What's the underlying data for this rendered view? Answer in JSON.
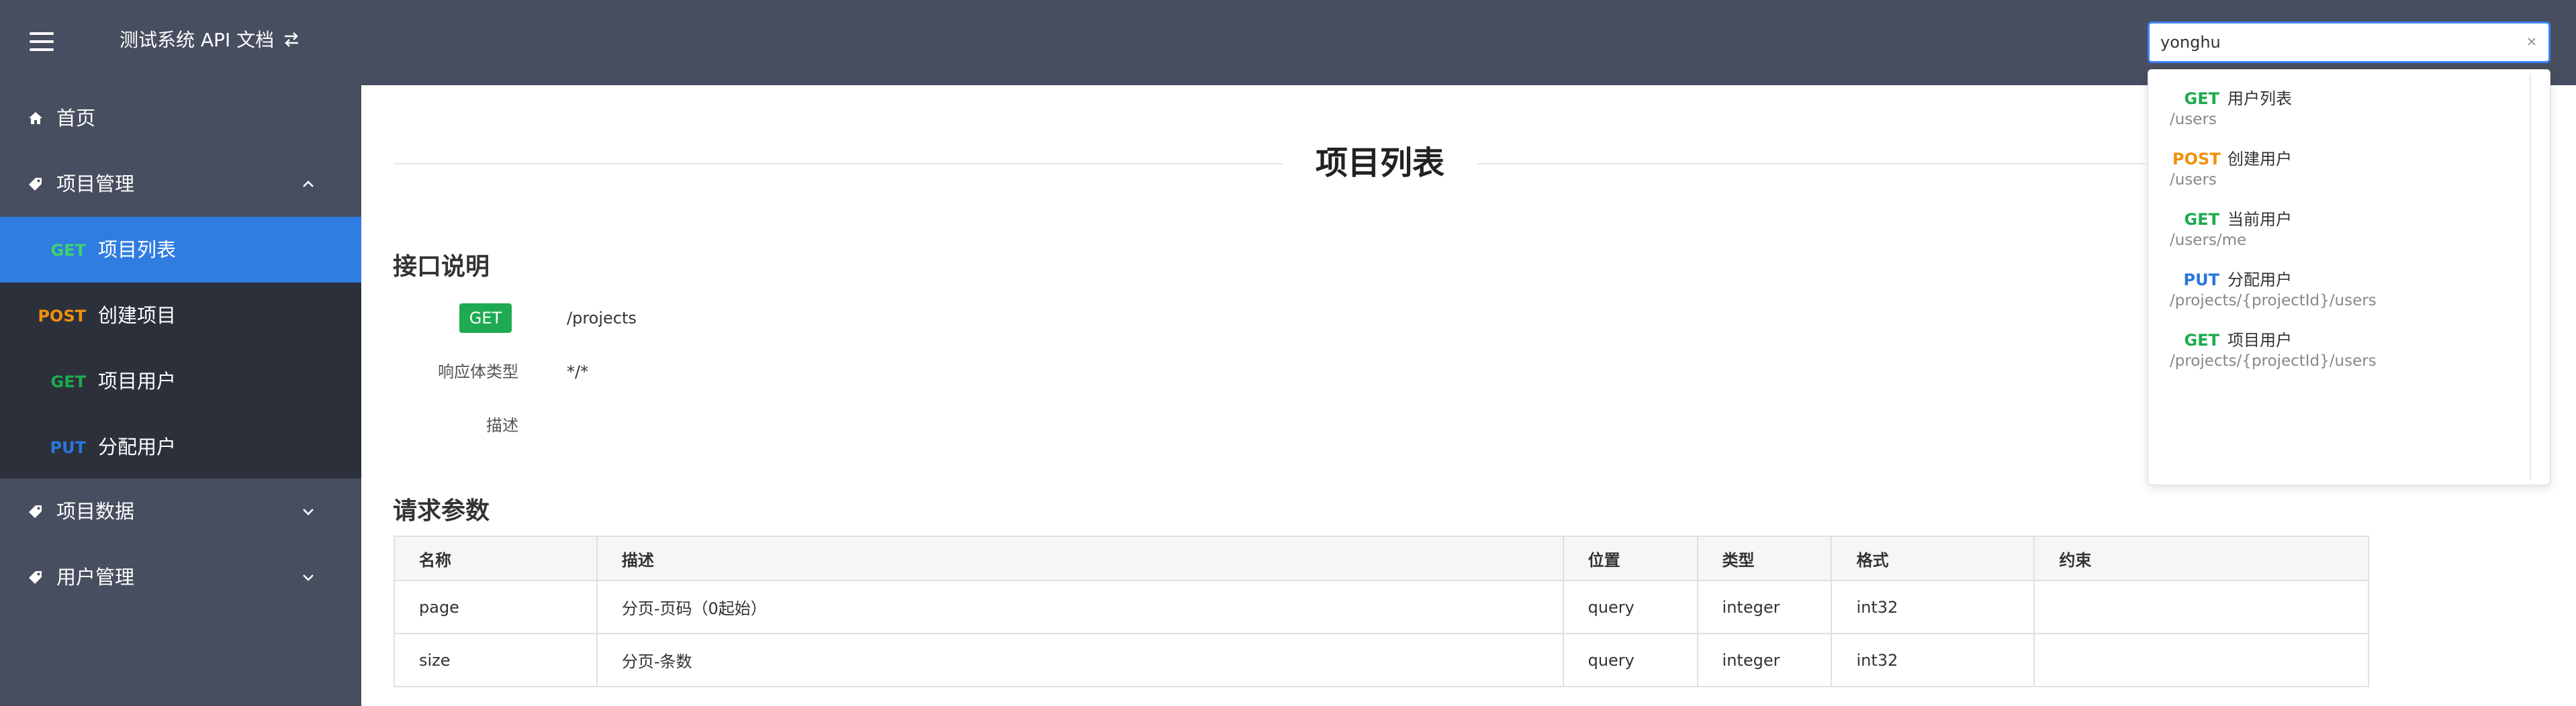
{
  "header": {
    "title": "测试系统 API 文档",
    "menu_icon": "hamburger-icon",
    "switch_icon": "swap-icon"
  },
  "search": {
    "value": "yonghu",
    "clear_icon": "close-icon",
    "results": [
      {
        "method": "GET",
        "name": "用户列表",
        "path": "/users"
      },
      {
        "method": "POST",
        "name": "创建用户",
        "path": "/users"
      },
      {
        "method": "GET",
        "name": "当前用户",
        "path": "/users/me"
      },
      {
        "method": "PUT",
        "name": "分配用户",
        "path": "/projects/{projectId}/users"
      },
      {
        "method": "GET",
        "name": "项目用户",
        "path": "/projects/{projectId}/users"
      }
    ]
  },
  "sidebar": {
    "home": {
      "label": "首页",
      "icon": "home-icon"
    },
    "groups": [
      {
        "label": "项目管理",
        "icon": "tag-icon",
        "expanded": true,
        "items": [
          {
            "method": "GET",
            "label": "项目列表",
            "active": true
          },
          {
            "method": "POST",
            "label": "创建项目"
          },
          {
            "method": "GET",
            "label": "项目用户"
          },
          {
            "method": "PUT",
            "label": "分配用户"
          }
        ]
      },
      {
        "label": "项目数据",
        "icon": "tag-icon",
        "expanded": false
      },
      {
        "label": "用户管理",
        "icon": "tag-icon",
        "expanded": false
      }
    ]
  },
  "main": {
    "title": "项目列表",
    "interface_section": "接口说明",
    "method": "GET",
    "path": "/projects",
    "response_type_label": "响应体类型",
    "response_type": "*/*",
    "description_label": "描述",
    "description": "",
    "params_section": "请求参数",
    "params_headers": [
      "名称",
      "描述",
      "位置",
      "类型",
      "格式",
      "约束"
    ],
    "params_rows": [
      [
        "page",
        "分页-页码（0起始）",
        "query",
        "integer",
        "int32",
        ""
      ],
      [
        "size",
        "分页-条数",
        "query",
        "integer",
        "int32",
        ""
      ]
    ]
  },
  "colors": {
    "header_bg": "#474e5f",
    "submenu_bg": "#2c303b",
    "active_bg": "#2f7de1",
    "get": "#1eaa50",
    "post": "#f0900d",
    "put": "#2a76dd"
  }
}
